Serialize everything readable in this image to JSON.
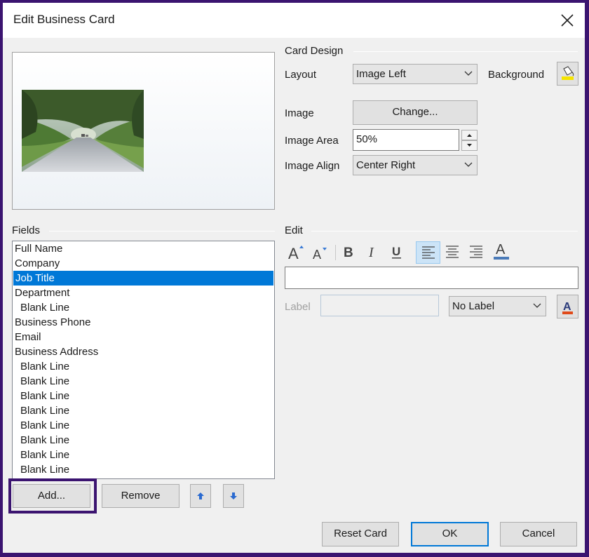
{
  "window": {
    "title": "Edit Business Card"
  },
  "card_design": {
    "group_label": "Card Design",
    "layout_label": "Layout",
    "layout_value": "Image Left",
    "background_label": "Background",
    "image_label": "Image",
    "change_button": "Change...",
    "image_area_label": "Image Area",
    "image_area_value": "50%",
    "image_align_label": "Image Align",
    "image_align_value": "Center Right"
  },
  "fields": {
    "group_label": "Fields",
    "items": [
      {
        "label": "Full Name",
        "indent": false
      },
      {
        "label": "Company",
        "indent": false
      },
      {
        "label": "Job Title",
        "indent": false,
        "selected": true
      },
      {
        "label": "Department",
        "indent": false
      },
      {
        "label": "Blank Line",
        "indent": true
      },
      {
        "label": "Business Phone",
        "indent": false
      },
      {
        "label": "Email",
        "indent": false
      },
      {
        "label": "Business Address",
        "indent": false
      },
      {
        "label": "Blank Line",
        "indent": true
      },
      {
        "label": "Blank Line",
        "indent": true
      },
      {
        "label": "Blank Line",
        "indent": true
      },
      {
        "label": "Blank Line",
        "indent": true
      },
      {
        "label": "Blank Line",
        "indent": true
      },
      {
        "label": "Blank Line",
        "indent": true
      },
      {
        "label": "Blank Line",
        "indent": true
      },
      {
        "label": "Blank Line",
        "indent": true
      }
    ],
    "add_button": "Add...",
    "remove_button": "Remove"
  },
  "edit": {
    "group_label": "Edit",
    "text_value": "",
    "label_label": "Label",
    "label_value": "",
    "label_position_value": "No Label"
  },
  "footer": {
    "reset_button": "Reset Card",
    "ok_button": "OK",
    "cancel_button": "Cancel"
  },
  "colors": {
    "accent": "#0078d7",
    "highlight_frame": "#3b1470",
    "font_color_bar": "#4a7ab8",
    "label_color_bar": "#e04a1a"
  },
  "icons": [
    "close-icon",
    "background-fill-icon",
    "move-up-icon",
    "move-down-icon",
    "grow-font-icon",
    "shrink-font-icon",
    "bold-icon",
    "italic-icon",
    "underline-icon",
    "align-left-icon",
    "align-center-icon",
    "align-right-icon",
    "font-color-icon",
    "label-color-icon",
    "chevron-down-icon",
    "spin-up-icon",
    "spin-down-icon"
  ]
}
